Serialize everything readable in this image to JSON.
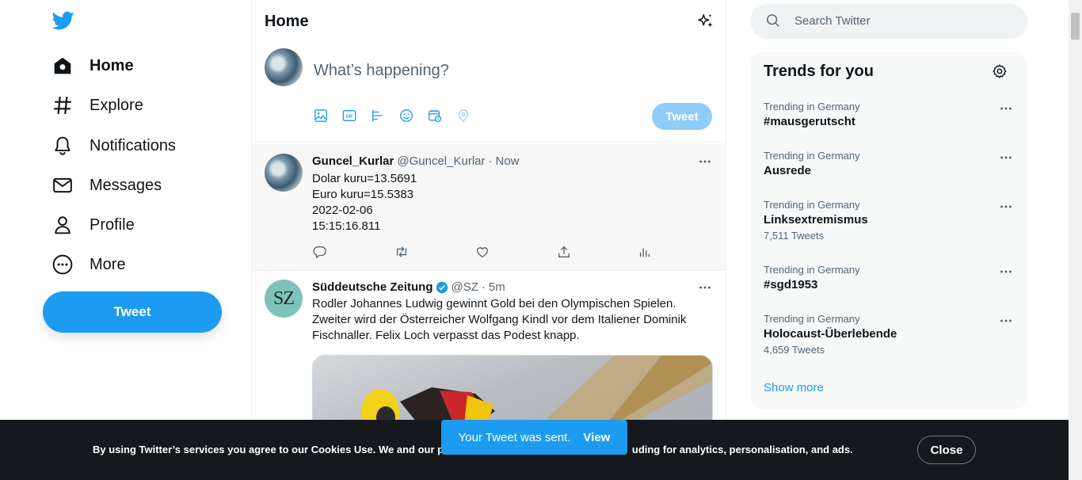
{
  "nav": {
    "items": [
      {
        "label": "Home",
        "icon": "home-icon"
      },
      {
        "label": "Explore",
        "icon": "hashtag-icon"
      },
      {
        "label": "Notifications",
        "icon": "bell-icon"
      },
      {
        "label": "Messages",
        "icon": "envelope-icon"
      },
      {
        "label": "Profile",
        "icon": "person-icon"
      },
      {
        "label": "More",
        "icon": "more-circle-icon"
      }
    ],
    "tweet_button": "Tweet"
  },
  "header": {
    "title": "Home"
  },
  "composer": {
    "placeholder": "What’s happening?",
    "tweet_button": "Tweet"
  },
  "tweets": [
    {
      "name": "Guncel_Kurlar",
      "handle": "@Guncel_Kurlar",
      "sep": "·",
      "time": "Now",
      "text": "Dolar kuru=13.5691\nEuro kuru=15.5383\n2022-02-06\n15:15:16.811"
    },
    {
      "name": "Süddeutsche Zeitung",
      "avatar_text": "SZ",
      "handle": "@SZ",
      "sep": "·",
      "time": "5m",
      "text": "Rodler Johannes Ludwig gewinnt Gold bei den Olympischen Spielen. Zweiter wird der Österreicher Wolfgang Kindl vor dem Italiener Dominik Fischnaller. Felix Loch verpasst das Podest knapp."
    }
  ],
  "search": {
    "placeholder": "Search Twitter"
  },
  "trends": {
    "title": "Trends for you",
    "items": [
      {
        "context": "Trending in Germany",
        "name": "#mausgerutscht",
        "count": ""
      },
      {
        "context": "Trending in Germany",
        "name": "Ausrede",
        "count": ""
      },
      {
        "context": "Trending in Germany",
        "name": "Linksextremismus",
        "count": "7,511 Tweets"
      },
      {
        "context": "Trending in Germany",
        "name": "#sgd1953",
        "count": ""
      },
      {
        "context": "Trending in Germany",
        "name": "Holocaust-Überlebende",
        "count": "4,659 Tweets"
      }
    ],
    "show_more": "Show more"
  },
  "toast": {
    "message": "Your Tweet was sent.",
    "action": "View"
  },
  "cookie": {
    "text_left": "By using Twitter’s services you agree to our Cookies Use. We and our partne",
    "text_right": "uding for analytics, personalisation, and ads.",
    "close": "Close"
  },
  "colors": {
    "accent": "#1d9bf0",
    "banner": "#15181c",
    "muted": "#536471"
  }
}
